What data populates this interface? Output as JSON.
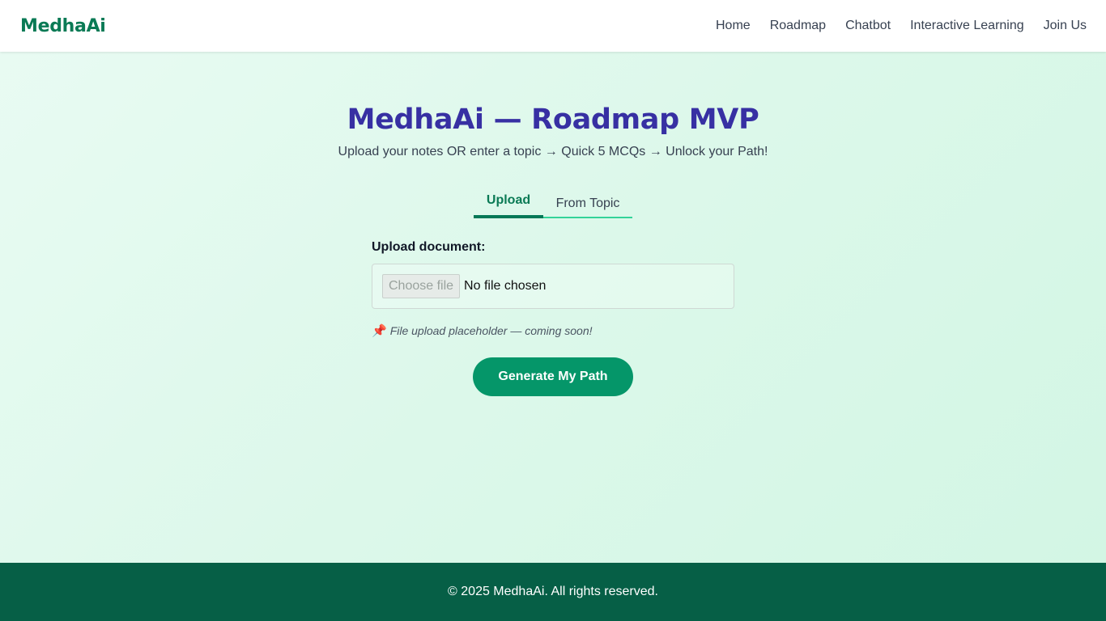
{
  "header": {
    "brand": "MedhaAi",
    "nav": [
      "Home",
      "Roadmap",
      "Chatbot",
      "Interactive Learning",
      "Join Us"
    ]
  },
  "main": {
    "title": "MedhaAi — Roadmap MVP",
    "subtitle": "Upload your notes OR enter a topic → Quick 5 MCQs → Unlock your Path!",
    "tabs": [
      {
        "label": "Upload",
        "active": true
      },
      {
        "label": "From Topic",
        "active": false
      }
    ],
    "upload_label": "Upload document:",
    "file_button": "Choose file",
    "file_status": "No file chosen",
    "note_icon": "pushpin-icon",
    "note": "File upload placeholder — coming soon!",
    "generate_label": "Generate My Path"
  },
  "footer": {
    "text": "© 2025 MedhaAi. All rights reserved."
  },
  "colors": {
    "brand": "#0a7a55",
    "title": "#3730a3",
    "button": "#059669",
    "footer": "#065f46"
  }
}
